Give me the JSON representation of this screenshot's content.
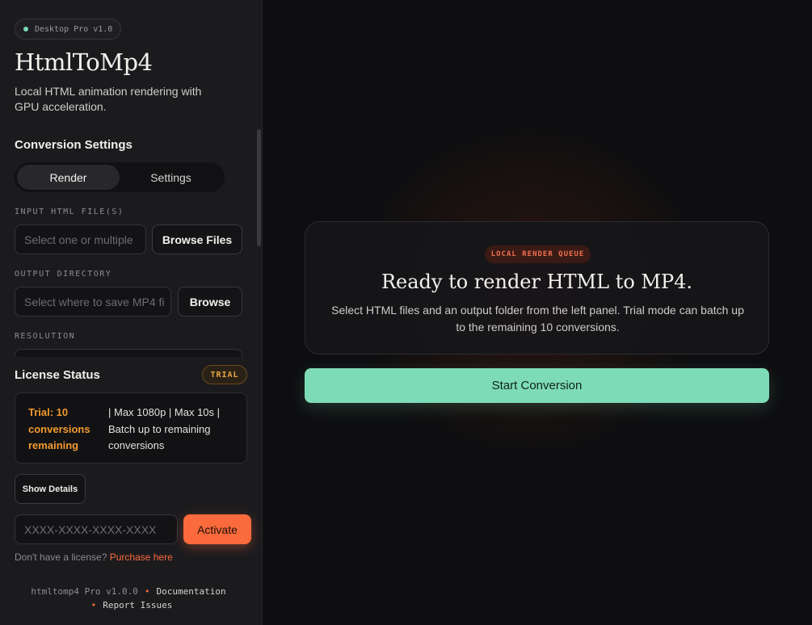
{
  "sidebar": {
    "version_badge": "Desktop Pro v1.0",
    "app_title": "HtmlToMp4",
    "app_subtitle": "Local HTML animation rendering with GPU acceleration.",
    "conversion_settings_title": "Conversion Settings",
    "tabs": [
      {
        "label": "Render",
        "active": true
      },
      {
        "label": "Settings",
        "active": false
      }
    ],
    "input_label": "INPUT HTML FILE(S)",
    "input_placeholder": "Select one or multiple",
    "browse_files_label": "Browse Files",
    "output_label": "OUTPUT DIRECTORY",
    "output_placeholder": "Select where to save MP4 fi",
    "browse_label": "Browse",
    "resolution_label": "RESOLUTION"
  },
  "license": {
    "title": "License Status",
    "badge": "TRIAL",
    "trial_text": "Trial: 10 conversions remaining",
    "limits_text": "| Max 1080p | Max 10s | Batch up to remaining conversions",
    "show_details_label": "Show Details",
    "key_placeholder": "XXXX-XXXX-XXXX-XXXX",
    "activate_label": "Activate",
    "no_license_text": "Don't have a license?",
    "purchase_link": "Purchase here"
  },
  "footer": {
    "version": "htmltomp4 Pro v1.0.0",
    "documentation": "Documentation",
    "report_issues": "Report Issues"
  },
  "main": {
    "queue_badge": "LOCAL RENDER QUEUE",
    "queue_title": "Ready to render HTML to MP4.",
    "queue_description": "Select HTML files and an output folder from the left panel. Trial mode can batch up to the remaining 10 conversions.",
    "start_button": "Start Conversion"
  },
  "colors": {
    "accent_orange": "#fb6a3c",
    "accent_green": "#7ddbb7",
    "trial_amber": "#f39a2e",
    "background": "#0e0e10",
    "sidebar_bg": "#1b1b1e"
  }
}
